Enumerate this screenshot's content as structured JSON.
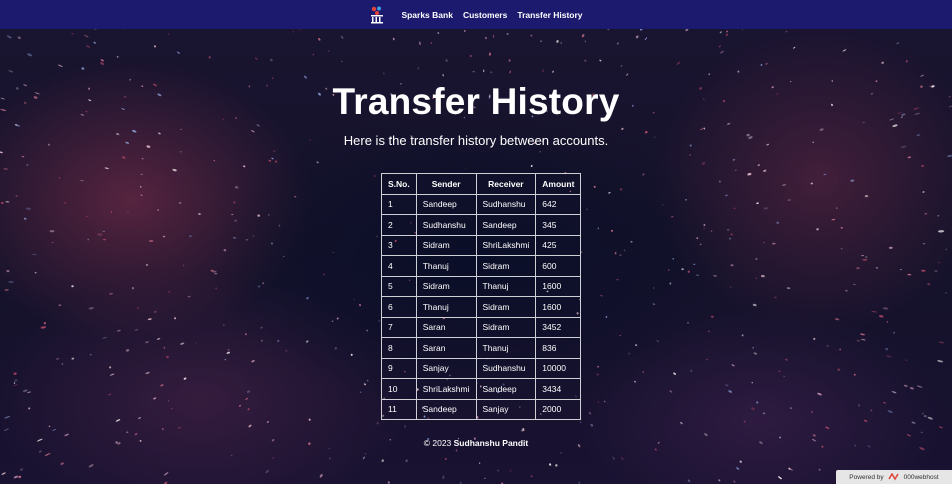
{
  "nav": {
    "brand": "Sparks Bank",
    "links": [
      "Customers",
      "Transfer History"
    ]
  },
  "page": {
    "title": "Transfer History",
    "subtitle": "Here is the transfer history between accounts."
  },
  "table": {
    "headers": [
      "S.No.",
      "Sender",
      "Receiver",
      "Amount"
    ],
    "rows": [
      [
        "1",
        "Sandeep",
        "Sudhanshu",
        "642"
      ],
      [
        "2",
        "Sudhanshu",
        "Sandeep",
        "345"
      ],
      [
        "3",
        "Sidram",
        "ShriLakshmi",
        "425"
      ],
      [
        "4",
        "Thanuj",
        "Sidram",
        "600"
      ],
      [
        "5",
        "Sidram",
        "Thanuj",
        "1600"
      ],
      [
        "6",
        "Thanuj",
        "Sidram",
        "1600"
      ],
      [
        "7",
        "Saran",
        "Sidram",
        "3452"
      ],
      [
        "8",
        "Saran",
        "Thanuj",
        "836"
      ],
      [
        "9",
        "Sanjay",
        "Sudhanshu",
        "10000"
      ],
      [
        "10",
        "ShriLakshmi",
        "Sandeep",
        "3434"
      ],
      [
        "11",
        "Sandeep",
        "Sanjay",
        "2000"
      ]
    ]
  },
  "footer": {
    "prefix": "© 2023 ",
    "author": "Sudhanshu Pandit"
  },
  "host_badge": {
    "powered_by": "Powered by",
    "name": "000webhost"
  },
  "colors": {
    "navbar": "#1b1a6e",
    "text": "#ffffff",
    "table_border": "#cfcfd6"
  },
  "icons": {
    "logo": "bank-logo-icon",
    "host": "000webhost-icon"
  }
}
